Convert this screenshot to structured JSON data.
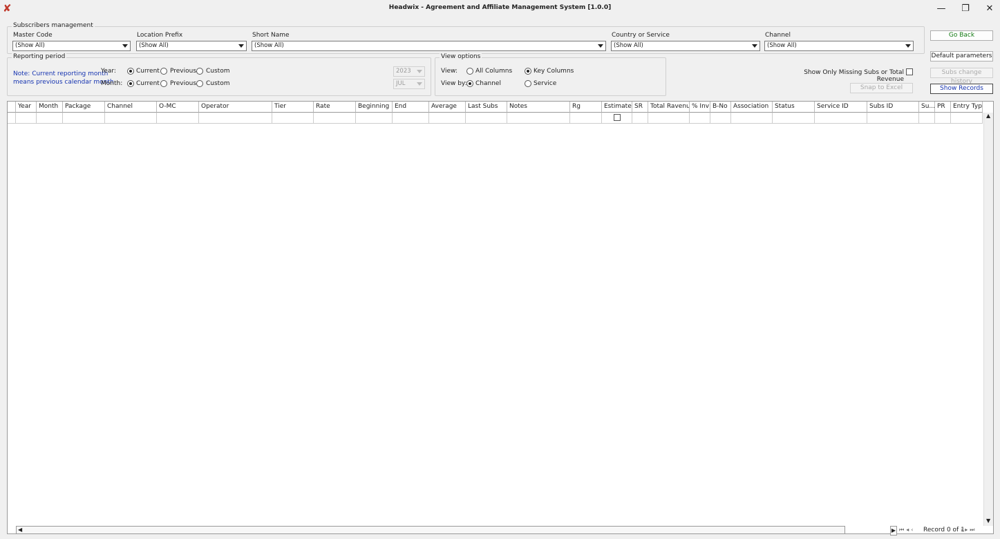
{
  "window": {
    "title": "Headwix - Agreement and Affiliate Management System [1.0.0]",
    "minimize_glyph": "—",
    "restore_glyph": "❐",
    "close_glyph": "✕",
    "app_icon_glyph": "✘"
  },
  "subscribers": {
    "group_title": "Subscribers management",
    "master_code": {
      "label": "Master Code",
      "value": "(Show All)"
    },
    "location_prefix": {
      "label": "Location Prefix",
      "value": "(Show All)"
    },
    "short_name": {
      "label": "Short Name",
      "value": "(Show All)"
    },
    "country_or_service": {
      "label": "Country or Service",
      "value": "(Show All)"
    },
    "channel": {
      "label": "Channel",
      "value": "(Show All)"
    }
  },
  "reporting": {
    "group_title": "Reporting period",
    "note_line1": "Note: Current reporting month",
    "note_line2": "means previous calendar month",
    "year_label": "Year:",
    "month_label": "Month:",
    "opt_current": "Current",
    "opt_previous": "Previous",
    "opt_custom": "Custom",
    "year_value": "2023",
    "month_value": "JUL"
  },
  "view_options": {
    "group_title": "View options",
    "view_label": "View:",
    "view_by_label": "View by:",
    "all_columns": "All Columns",
    "key_columns": "Key Columns",
    "channel": "Channel",
    "service": "Service"
  },
  "actions": {
    "go_back": "Go Back",
    "default_parameters": "Default parameters",
    "subs_change_history": "Subs change history",
    "snap_to_excel": "Snap to Excel",
    "show_records": "Show Records",
    "missing_label": "Show Only Missing Subs or Total Revenue"
  },
  "grid": {
    "columns": [
      "Year",
      "Month",
      "Package",
      "Channel",
      "O-MC",
      "Operator",
      "Tier",
      "Rate",
      "Beginning",
      "End",
      "Average",
      "Last Subs",
      "Notes",
      "Rg",
      "Estimated",
      "SR",
      "Total Ravenue",
      "% Inv",
      "B-No",
      "Association",
      "Status",
      "Service ID",
      "Subs ID",
      "Su...",
      "PR",
      "Entry Type"
    ],
    "record_nav": "Record 0 of 1"
  },
  "colors": {
    "note_blue": "#1533b0",
    "go_back_green": "#127a12",
    "app_icon_red": "#c0392b"
  }
}
